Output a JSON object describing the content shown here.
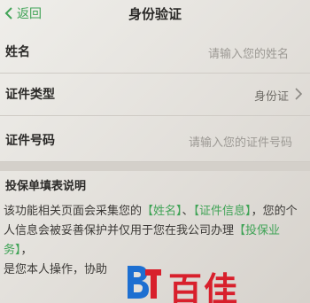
{
  "nav": {
    "back_label": "返回",
    "title": "身份验证"
  },
  "form": {
    "name_label": "姓名",
    "name_placeholder": "请输入您的姓名",
    "id_type_label": "证件类型",
    "id_type_value": "身份证",
    "id_number_label": "证件号码",
    "id_number_placeholder": "请输入您的证件号码"
  },
  "notice": {
    "title": "投保单填表说明",
    "part1": "该功能相关页面会采集您的",
    "hl1": "【姓名】",
    "part2": "、",
    "hl2": "【证件信息】",
    "part3": "，您的个人信息会被妥善保护并仅用于您在我公司办理",
    "hl3": "【投保业务】",
    "part4": "，",
    "part5": "是您本人操作，协助"
  },
  "watermark": {
    "text": "百佳"
  },
  "colors": {
    "accent": "#3fa356",
    "watermark_red": "#d8202c",
    "watermark_blue": "#1d6fd1"
  }
}
